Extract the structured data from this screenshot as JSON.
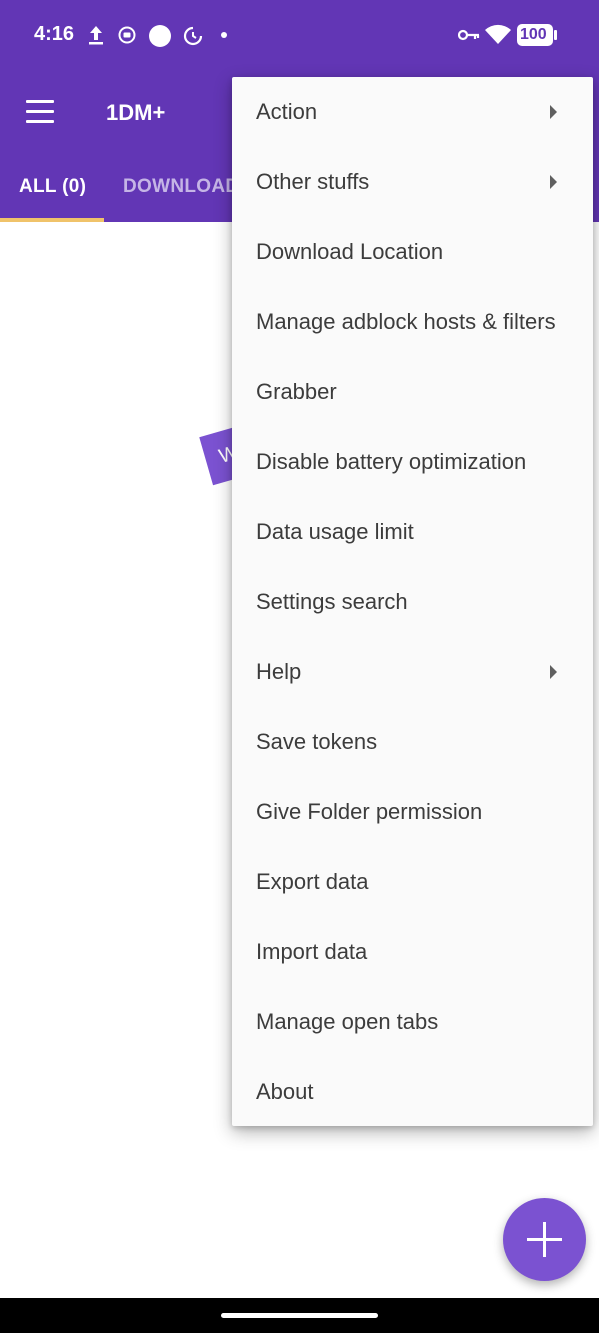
{
  "status_bar": {
    "time": "4:16",
    "battery": "100",
    "left_icons": [
      "upload-icon",
      "media-icon",
      "circle-icon",
      "dnd-icon",
      "dot-icon"
    ],
    "right_icons": [
      "vpn-key-icon",
      "wifi-icon",
      "battery-icon"
    ]
  },
  "app_bar": {
    "title": "1DM+",
    "menu_icon": "hamburger-menu-icon"
  },
  "tabs": [
    {
      "label": "ALL (0)",
      "selected": true
    },
    {
      "label": "DOWNLOAD",
      "selected": false
    }
  ],
  "background_sticker": {
    "text": "W"
  },
  "overflow_menu": {
    "items": [
      {
        "label": "Action",
        "has_submenu": true
      },
      {
        "label": "Other stuffs",
        "has_submenu": true
      },
      {
        "label": "Download Location",
        "has_submenu": false
      },
      {
        "label": "Manage adblock hosts & filters",
        "has_submenu": false
      },
      {
        "label": "Grabber",
        "has_submenu": false
      },
      {
        "label": "Disable battery optimization",
        "has_submenu": false
      },
      {
        "label": "Data usage limit",
        "has_submenu": false
      },
      {
        "label": "Settings search",
        "has_submenu": false
      },
      {
        "label": "Help",
        "has_submenu": true
      },
      {
        "label": "Save tokens",
        "has_submenu": false
      },
      {
        "label": "Give Folder permission",
        "has_submenu": false
      },
      {
        "label": "Export data",
        "has_submenu": false
      },
      {
        "label": "Import data",
        "has_submenu": false
      },
      {
        "label": "Manage open tabs",
        "has_submenu": false
      },
      {
        "label": "About",
        "has_submenu": false
      }
    ]
  },
  "fab": {
    "icon": "plus-icon"
  },
  "colors": {
    "primary": "#6236b5",
    "accent": "#7b52d1",
    "tab_indicator": "#f0c36a",
    "menu_background": "#fafafa"
  }
}
